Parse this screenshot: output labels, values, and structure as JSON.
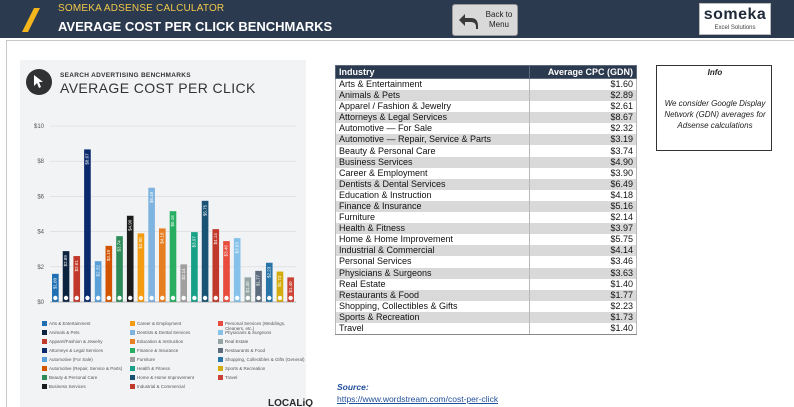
{
  "header": {
    "app_title": "SOMEKA ADSENSE CALCULATOR",
    "page_heading": "AVERAGE COST PER CLICK BENCHMARKS",
    "back_button": {
      "line1": "Back to",
      "line2": "Menu"
    },
    "brand": {
      "name": "someka",
      "subtitle": "Excel Solutions"
    },
    "colors": {
      "bar": "#2b3a4e",
      "title_accent": "#f2c84b",
      "logo": "#f2b51c"
    }
  },
  "image_panel": {
    "kicker": "SEARCH ADVERTISING BENCHMARKS",
    "title": "AVERAGE COST PER CLICK",
    "brand": "LOCALiQ",
    "icon": "cursor-icon",
    "legend": [
      {
        "label": "Arts & Entertainment",
        "color": "#1f6fb2"
      },
      {
        "label": "Animals & Pets",
        "color": "#0c2340"
      },
      {
        "label": "Apparel/Fashion & Jewelry",
        "color": "#c0392b"
      },
      {
        "label": "Attorneys & Legal Services",
        "color": "#0b2a6b"
      },
      {
        "label": "Automotive (For Sale)",
        "color": "#5aa0d8"
      },
      {
        "label": "Automotive (Repair, Service & Parts)",
        "color": "#d35400"
      },
      {
        "label": "Beauty & Personal Care",
        "color": "#2e8b57"
      },
      {
        "label": "Business Services",
        "color": "#1b1b1b"
      },
      {
        "label": "Career & Employment",
        "color": "#f39c12"
      },
      {
        "label": "Dentists & Dental Services",
        "color": "#7fb3e0"
      },
      {
        "label": "Education & Instruction",
        "color": "#e67e22"
      },
      {
        "label": "Finance & Insurance",
        "color": "#27ae60"
      },
      {
        "label": "Furniture",
        "color": "#a0a0a0"
      },
      {
        "label": "Health & Fitness",
        "color": "#16a085"
      },
      {
        "label": "Home & Home Improvement",
        "color": "#1a5276"
      },
      {
        "label": "Industrial & Commercial",
        "color": "#c0392b"
      },
      {
        "label": "Personal Services (Weddings, Cleaners, etc.)",
        "color": "#e74c3c"
      },
      {
        "label": "Physicians & Surgeons",
        "color": "#85c1e9"
      },
      {
        "label": "Real Estate",
        "color": "#95a5a6"
      },
      {
        "label": "Restaurants & Food",
        "color": "#5d6d7e"
      },
      {
        "label": "Shopping, Collectibles & Gifts (General)",
        "color": "#2874a6"
      },
      {
        "label": "Sports & Recreation",
        "color": "#d4ac0d"
      },
      {
        "label": "Travel",
        "color": "#cb4335"
      }
    ]
  },
  "chart_data": {
    "type": "bar",
    "title": "AVERAGE COST PER CLICK",
    "ylim": [
      0,
      10
    ],
    "yticks": [
      "$0",
      "$2",
      "$4",
      "$6",
      "$8",
      "$10"
    ],
    "categories": [
      "Arts & Entertainment",
      "Animals & Pets",
      "Apparel / Fashion & Jewelry",
      "Attorneys & Legal Services",
      "Automotive — For Sale",
      "Automotive — Repair, Service & Parts",
      "Beauty & Personal Care",
      "Business Services",
      "Career & Employment",
      "Dentists & Dental Services",
      "Education & Instruction",
      "Finance & Insurance",
      "Furniture",
      "Health & Fitness",
      "Home & Home Improvement",
      "Industrial & Commercial",
      "Personal Services",
      "Physicians & Surgeons",
      "Real Estate",
      "Restaurants & Food",
      "Shopping, Collectibles & Gifts",
      "Sports & Recreation",
      "Travel"
    ],
    "values": [
      1.6,
      2.89,
      2.61,
      8.67,
      2.32,
      3.19,
      3.74,
      4.9,
      3.9,
      6.49,
      4.18,
      5.16,
      2.14,
      3.97,
      5.75,
      4.14,
      3.46,
      3.63,
      1.4,
      1.77,
      2.23,
      1.73,
      1.4
    ],
    "data_labels": [
      "$1.60",
      "$2.89",
      "$2.61",
      "$8.67",
      "$2.32",
      "$3.19",
      "$3.74",
      "$4.90",
      "$3.90",
      "$6.49",
      "$4.18",
      "$5.16",
      "$2.14",
      "$3.97",
      "$5.75",
      "$4.14",
      "$3.46",
      "$3.63",
      "$1.40",
      "$1.77",
      "$2.23",
      "$1.73",
      "$1.40"
    ],
    "grid": true,
    "legend": "bottom"
  },
  "table": {
    "headers": {
      "industry": "Industry",
      "cpc": "Average CPC (GDN)"
    },
    "rows": [
      {
        "industry": "Arts & Entertainment",
        "cpc": "$1.60"
      },
      {
        "industry": "Animals & Pets",
        "cpc": "$2.89"
      },
      {
        "industry": "Apparel / Fashion & Jewelry",
        "cpc": "$2.61"
      },
      {
        "industry": "Attorneys & Legal Services",
        "cpc": "$8.67"
      },
      {
        "industry": "Automotive — For Sale",
        "cpc": "$2.32"
      },
      {
        "industry": "Automotive — Repair, Service & Parts",
        "cpc": "$3.19"
      },
      {
        "industry": "Beauty & Personal Care",
        "cpc": "$3.74"
      },
      {
        "industry": "Business Services",
        "cpc": "$4.90"
      },
      {
        "industry": "Career & Employment",
        "cpc": "$3.90"
      },
      {
        "industry": "Dentists & Dental Services",
        "cpc": "$6.49"
      },
      {
        "industry": "Education & Instruction",
        "cpc": "$4.18"
      },
      {
        "industry": "Finance & Insurance",
        "cpc": "$5.16"
      },
      {
        "industry": "Furniture",
        "cpc": "$2.14"
      },
      {
        "industry": "Health & Fitness",
        "cpc": "$3.97"
      },
      {
        "industry": "Home & Home Improvement",
        "cpc": "$5.75"
      },
      {
        "industry": "Industrial & Commercial",
        "cpc": "$4.14"
      },
      {
        "industry": "Personal Services",
        "cpc": "$3.46"
      },
      {
        "industry": "Physicians & Surgeons",
        "cpc": "$3.63"
      },
      {
        "industry": "Real Estate",
        "cpc": "$1.40"
      },
      {
        "industry": "Restaurants & Food",
        "cpc": "$1.77"
      },
      {
        "industry": "Shopping, Collectibles & Gifts",
        "cpc": "$2.23"
      },
      {
        "industry": "Sports & Recreation",
        "cpc": "$1.73"
      },
      {
        "industry": "Travel",
        "cpc": "$1.40"
      }
    ]
  },
  "info": {
    "title": "Info",
    "text": "We consider Google Display Network (GDN) averages for Adsense calculations"
  },
  "source": {
    "label": "Source:",
    "link": "https://www.wordstream.com/cost-per-click"
  }
}
